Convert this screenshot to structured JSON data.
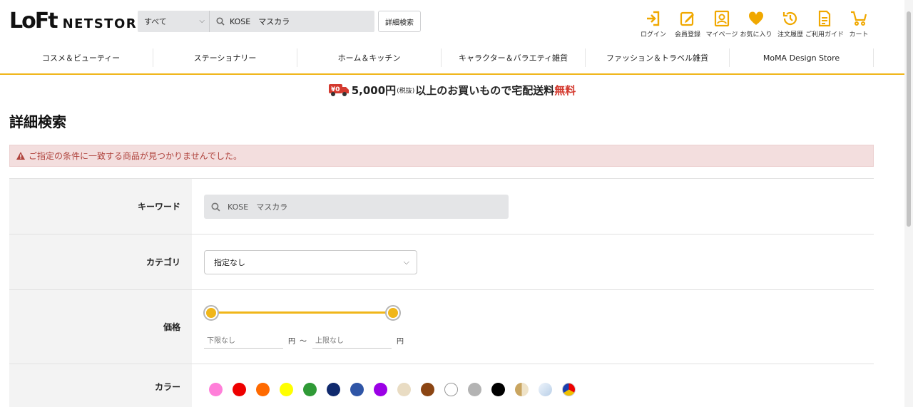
{
  "header": {
    "logo_main": "LoFt",
    "logo_sub": "NETSTORE",
    "search": {
      "scope": "すべて",
      "query": "KOSE　マスカラ"
    },
    "detail_search_button": "詳細検索",
    "icons": [
      {
        "name": "login-icon",
        "label": "ログイン"
      },
      {
        "name": "register-icon",
        "label": "会員登録"
      },
      {
        "name": "mypage-icon",
        "label": "マイページ"
      },
      {
        "name": "favorite-icon",
        "label": "お気に入り"
      },
      {
        "name": "history-icon",
        "label": "注文履歴"
      },
      {
        "name": "guide-icon",
        "label": "ご利用ガイド"
      },
      {
        "name": "cart-icon",
        "label": "カート"
      }
    ],
    "accent_color": "#f0b61a"
  },
  "nav": {
    "items": [
      "コスメ＆ビューティー",
      "ステーショナリー",
      "ホーム＆キッチン",
      "キャラクター＆バラエティ雑貨",
      "ファッション＆トラベル雑貨",
      "MoMA Design Store"
    ]
  },
  "promo": {
    "badge": "¥0",
    "amount": "5,000円",
    "tax": "(税抜)",
    "text": "以上のお買いもので宅配送料",
    "free": "無料"
  },
  "page_title": "詳細検索",
  "alert": {
    "message": "ご指定の条件に一致する商品が見つかりませんでした。",
    "color": "#b0443e"
  },
  "form": {
    "keyword": {
      "label": "キーワード",
      "value": "KOSE　マスカラ"
    },
    "category": {
      "label": "カテゴリ",
      "value": "指定なし"
    },
    "price": {
      "label": "価格",
      "min_placeholder": "下限なし",
      "max_placeholder": "上限なし",
      "yen": "円",
      "tilde": "〜",
      "range_fraction": [
        0,
        1
      ]
    },
    "color": {
      "label": "カラー",
      "swatches": [
        "#ff7fd9",
        "#ee0000",
        "#ff6a00",
        "#ffff00",
        "#2f9a36",
        "#102a6e",
        "#2f55a6",
        "#9b00e6",
        "#e9dcc3",
        "#8b4513",
        "#ffffff",
        "#b3b3b3",
        "#000000",
        "#d7c09a",
        "#c8dcf2",
        "multi"
      ]
    }
  }
}
